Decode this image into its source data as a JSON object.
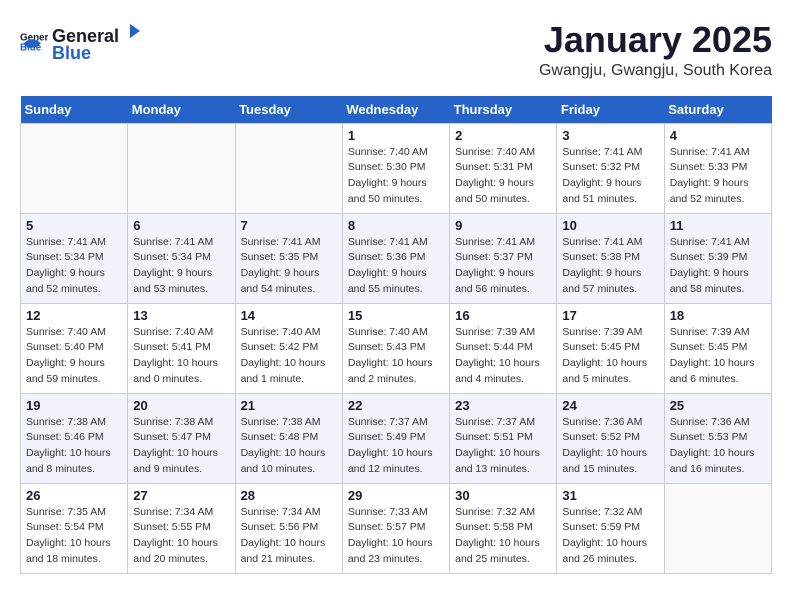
{
  "header": {
    "logo_general": "General",
    "logo_blue": "Blue",
    "title": "January 2025",
    "subtitle": "Gwangju, Gwangju, South Korea"
  },
  "days_of_week": [
    "Sunday",
    "Monday",
    "Tuesday",
    "Wednesday",
    "Thursday",
    "Friday",
    "Saturday"
  ],
  "weeks": [
    {
      "row_class": "week-row-1",
      "days": [
        {
          "num": "",
          "info": "",
          "empty": true
        },
        {
          "num": "",
          "info": "",
          "empty": true
        },
        {
          "num": "",
          "info": "",
          "empty": true
        },
        {
          "num": "1",
          "info": "Sunrise: 7:40 AM\nSunset: 5:30 PM\nDaylight: 9 hours\nand 50 minutes.",
          "empty": false
        },
        {
          "num": "2",
          "info": "Sunrise: 7:40 AM\nSunset: 5:31 PM\nDaylight: 9 hours\nand 50 minutes.",
          "empty": false
        },
        {
          "num": "3",
          "info": "Sunrise: 7:41 AM\nSunset: 5:32 PM\nDaylight: 9 hours\nand 51 minutes.",
          "empty": false
        },
        {
          "num": "4",
          "info": "Sunrise: 7:41 AM\nSunset: 5:33 PM\nDaylight: 9 hours\nand 52 minutes.",
          "empty": false
        }
      ]
    },
    {
      "row_class": "week-row-2",
      "days": [
        {
          "num": "5",
          "info": "Sunrise: 7:41 AM\nSunset: 5:34 PM\nDaylight: 9 hours\nand 52 minutes.",
          "empty": false
        },
        {
          "num": "6",
          "info": "Sunrise: 7:41 AM\nSunset: 5:34 PM\nDaylight: 9 hours\nand 53 minutes.",
          "empty": false
        },
        {
          "num": "7",
          "info": "Sunrise: 7:41 AM\nSunset: 5:35 PM\nDaylight: 9 hours\nand 54 minutes.",
          "empty": false
        },
        {
          "num": "8",
          "info": "Sunrise: 7:41 AM\nSunset: 5:36 PM\nDaylight: 9 hours\nand 55 minutes.",
          "empty": false
        },
        {
          "num": "9",
          "info": "Sunrise: 7:41 AM\nSunset: 5:37 PM\nDaylight: 9 hours\nand 56 minutes.",
          "empty": false
        },
        {
          "num": "10",
          "info": "Sunrise: 7:41 AM\nSunset: 5:38 PM\nDaylight: 9 hours\nand 57 minutes.",
          "empty": false
        },
        {
          "num": "11",
          "info": "Sunrise: 7:41 AM\nSunset: 5:39 PM\nDaylight: 9 hours\nand 58 minutes.",
          "empty": false
        }
      ]
    },
    {
      "row_class": "week-row-3",
      "days": [
        {
          "num": "12",
          "info": "Sunrise: 7:40 AM\nSunset: 5:40 PM\nDaylight: 9 hours\nand 59 minutes.",
          "empty": false
        },
        {
          "num": "13",
          "info": "Sunrise: 7:40 AM\nSunset: 5:41 PM\nDaylight: 10 hours\nand 0 minutes.",
          "empty": false
        },
        {
          "num": "14",
          "info": "Sunrise: 7:40 AM\nSunset: 5:42 PM\nDaylight: 10 hours\nand 1 minute.",
          "empty": false
        },
        {
          "num": "15",
          "info": "Sunrise: 7:40 AM\nSunset: 5:43 PM\nDaylight: 10 hours\nand 2 minutes.",
          "empty": false
        },
        {
          "num": "16",
          "info": "Sunrise: 7:39 AM\nSunset: 5:44 PM\nDaylight: 10 hours\nand 4 minutes.",
          "empty": false
        },
        {
          "num": "17",
          "info": "Sunrise: 7:39 AM\nSunset: 5:45 PM\nDaylight: 10 hours\nand 5 minutes.",
          "empty": false
        },
        {
          "num": "18",
          "info": "Sunrise: 7:39 AM\nSunset: 5:45 PM\nDaylight: 10 hours\nand 6 minutes.",
          "empty": false
        }
      ]
    },
    {
      "row_class": "week-row-4",
      "days": [
        {
          "num": "19",
          "info": "Sunrise: 7:38 AM\nSunset: 5:46 PM\nDaylight: 10 hours\nand 8 minutes.",
          "empty": false
        },
        {
          "num": "20",
          "info": "Sunrise: 7:38 AM\nSunset: 5:47 PM\nDaylight: 10 hours\nand 9 minutes.",
          "empty": false
        },
        {
          "num": "21",
          "info": "Sunrise: 7:38 AM\nSunset: 5:48 PM\nDaylight: 10 hours\nand 10 minutes.",
          "empty": false
        },
        {
          "num": "22",
          "info": "Sunrise: 7:37 AM\nSunset: 5:49 PM\nDaylight: 10 hours\nand 12 minutes.",
          "empty": false
        },
        {
          "num": "23",
          "info": "Sunrise: 7:37 AM\nSunset: 5:51 PM\nDaylight: 10 hours\nand 13 minutes.",
          "empty": false
        },
        {
          "num": "24",
          "info": "Sunrise: 7:36 AM\nSunset: 5:52 PM\nDaylight: 10 hours\nand 15 minutes.",
          "empty": false
        },
        {
          "num": "25",
          "info": "Sunrise: 7:36 AM\nSunset: 5:53 PM\nDaylight: 10 hours\nand 16 minutes.",
          "empty": false
        }
      ]
    },
    {
      "row_class": "week-row-5",
      "days": [
        {
          "num": "26",
          "info": "Sunrise: 7:35 AM\nSunset: 5:54 PM\nDaylight: 10 hours\nand 18 minutes.",
          "empty": false
        },
        {
          "num": "27",
          "info": "Sunrise: 7:34 AM\nSunset: 5:55 PM\nDaylight: 10 hours\nand 20 minutes.",
          "empty": false
        },
        {
          "num": "28",
          "info": "Sunrise: 7:34 AM\nSunset: 5:56 PM\nDaylight: 10 hours\nand 21 minutes.",
          "empty": false
        },
        {
          "num": "29",
          "info": "Sunrise: 7:33 AM\nSunset: 5:57 PM\nDaylight: 10 hours\nand 23 minutes.",
          "empty": false
        },
        {
          "num": "30",
          "info": "Sunrise: 7:32 AM\nSunset: 5:58 PM\nDaylight: 10 hours\nand 25 minutes.",
          "empty": false
        },
        {
          "num": "31",
          "info": "Sunrise: 7:32 AM\nSunset: 5:59 PM\nDaylight: 10 hours\nand 26 minutes.",
          "empty": false
        },
        {
          "num": "",
          "info": "",
          "empty": true
        }
      ]
    }
  ]
}
